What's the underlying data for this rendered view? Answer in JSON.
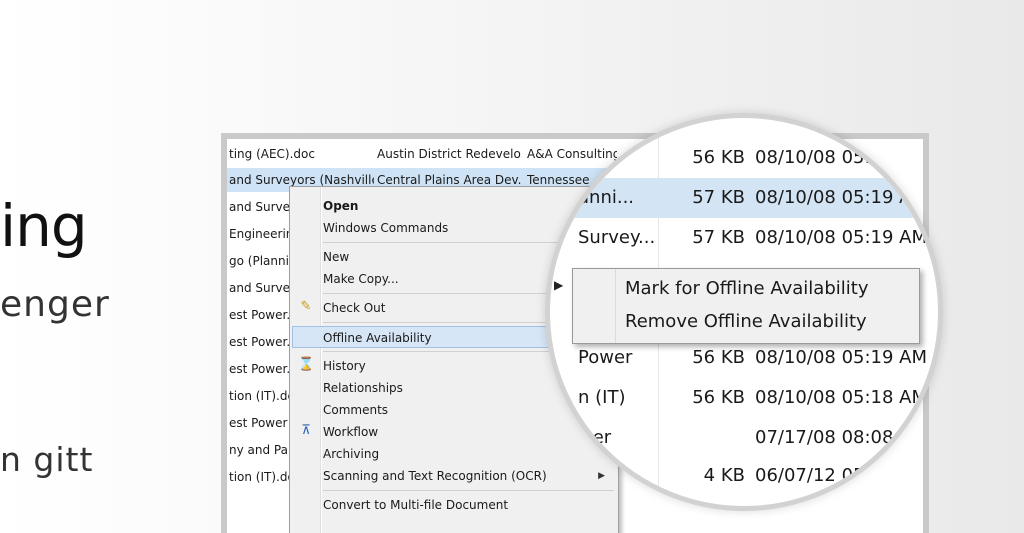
{
  "slide": {
    "title": "ing",
    "subtitle": "enger",
    "note": "n gitt"
  },
  "explorer": {
    "rows": [
      {
        "name": "ting (AEC).doc",
        "project": "Austin District Redevelo...",
        "client": "A&A Consulting",
        "selected": false
      },
      {
        "name": "and Surveyors (Nashville)",
        "project": "Central Plains Area Dev...",
        "client": "Tennessee",
        "selected": true
      },
      {
        "name": "and Surveyo",
        "project": "",
        "client": "",
        "selected": false
      },
      {
        "name": "Engineering",
        "project": "",
        "client": "",
        "selected": false
      },
      {
        "name": "go (Plannir",
        "project": "",
        "client": "",
        "selected": false
      },
      {
        "name": "and Surveyo",
        "project": "",
        "client": "",
        "selected": false
      },
      {
        "name": "est Power.d",
        "project": "",
        "client": "",
        "selected": false
      },
      {
        "name": "est Power.d",
        "project": "",
        "client": "",
        "selected": false
      },
      {
        "name": "est Power.d",
        "project": "",
        "client": "",
        "selected": false
      },
      {
        "name": "tion (IT).dc",
        "project": "",
        "client": "",
        "selected": false
      },
      {
        "name": "est Power",
        "project": "",
        "client": "",
        "selected": false
      },
      {
        "name": "ny and Part",
        "project": "",
        "client": "",
        "selected": false
      },
      {
        "name": "tion (IT).do",
        "project": "",
        "client": "",
        "selected": false
      }
    ]
  },
  "context_menu": {
    "open": "Open",
    "windows_commands": "Windows Commands",
    "new": "New",
    "make_copy": "Make Copy...",
    "check_out": "Check Out",
    "offline_availability": "Offline Availability",
    "history": "History",
    "relationships": "Relationships",
    "comments": "Comments",
    "workflow": "Workflow",
    "archiving": "Archiving",
    "scanning": "Scanning and Text Recognition (OCR)",
    "convert": "Convert to Multi-file Document"
  },
  "magnifier": {
    "rows": [
      {
        "name": "",
        "size": "56 KB",
        "date": "08/10/08 05:"
      },
      {
        "name": "anni...",
        "size": "57 KB",
        "date": "08/10/08 05:19 AM"
      },
      {
        "name": "Survey...",
        "size": "57 KB",
        "date": "08/10/08 05:19 AM"
      },
      {
        "name": "Power",
        "size": "56 KB",
        "date": "08/10/08 05:19 AM"
      },
      {
        "name": "n (IT)",
        "size": "56 KB",
        "date": "08/10/08 05:18 AM"
      },
      {
        "name": "wer",
        "size": "",
        "date": "07/17/08 08:08 AM"
      },
      {
        "name": "",
        "size": "4 KB",
        "date": "06/07/12 05:3"
      }
    ],
    "submenu": {
      "mark": "Mark for Offline Availability",
      "remove": "Remove Offline Availability"
    }
  }
}
